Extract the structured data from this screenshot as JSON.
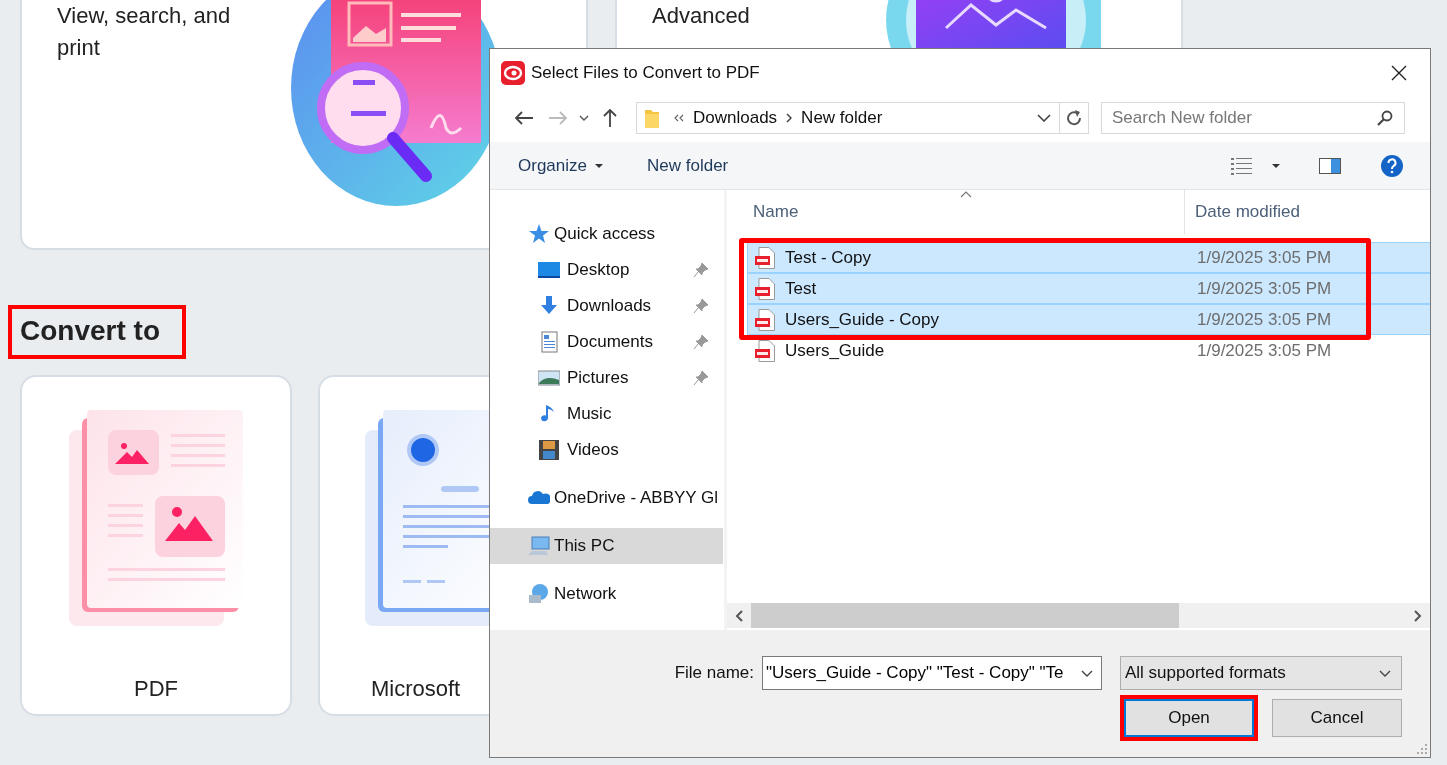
{
  "app": {
    "feature_cards": [
      {
        "kind": "search",
        "text": "View, search, and print"
      },
      {
        "kind": "image",
        "text": "Advanced"
      }
    ],
    "section_heading": {
      "text": "Convert to",
      "highlighted": true
    },
    "convert_cards": [
      {
        "kind": "pdf",
        "label": "PDF"
      },
      {
        "kind": "word",
        "label": "Microsoft"
      }
    ]
  },
  "dialog": {
    "title": "Select Files to Convert to PDF",
    "address": {
      "path": [
        "Downloads",
        "New folder"
      ]
    },
    "search": {
      "placeholder": "Search New folder"
    },
    "toolbar": {
      "organize": "Organize",
      "new_folder": "New folder"
    },
    "nav": [
      {
        "label": "Quick access",
        "kind": "star",
        "selected": false,
        "children": [
          {
            "label": "Desktop",
            "kind": "desktop",
            "pinned": true,
            "selected": false
          },
          {
            "label": "Downloads",
            "kind": "download",
            "pinned": true,
            "selected": false
          },
          {
            "label": "Documents",
            "kind": "documents",
            "pinned": true,
            "selected": false
          },
          {
            "label": "Pictures",
            "kind": "pictures",
            "pinned": true,
            "selected": false
          },
          {
            "label": "Music",
            "kind": "music",
            "pinned": false,
            "selected": false
          },
          {
            "label": "Videos",
            "kind": "videos",
            "pinned": false,
            "selected": false
          }
        ]
      },
      {
        "label": "OneDrive - ABBYY Gl",
        "kind": "cloud",
        "selected": false
      },
      {
        "label": "This PC",
        "kind": "pc",
        "selected": true
      },
      {
        "label": "Network",
        "kind": "network",
        "selected": false
      }
    ],
    "columns": [
      "Name",
      "Date modified"
    ],
    "file_list": {
      "highlight_selection": true,
      "files": [
        {
          "name": "Test - Copy",
          "date": "1/9/2025 3:05 PM",
          "selected": true
        },
        {
          "name": "Test",
          "date": "1/9/2025 3:05 PM",
          "selected": true
        },
        {
          "name": "Users_Guide - Copy",
          "date": "1/9/2025 3:05 PM",
          "selected": true
        },
        {
          "name": "Users_Guide",
          "date": "1/9/2025 3:05 PM",
          "selected": false
        }
      ]
    },
    "file_name": {
      "label": "File name:",
      "value": "\"Users_Guide - Copy\" \"Test - Copy\" \"Te"
    },
    "file_type": "All supported formats",
    "buttons": [
      {
        "kind": "open",
        "label": "Open",
        "highlighted": true
      },
      {
        "kind": "cancel",
        "label": "Cancel",
        "highlighted": false
      }
    ]
  }
}
